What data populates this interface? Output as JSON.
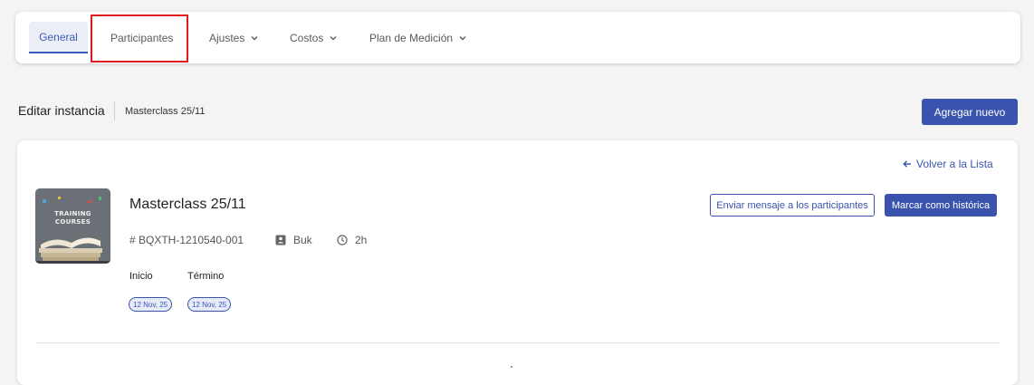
{
  "tabs": [
    {
      "label": "General",
      "active": true
    },
    {
      "label": "Participantes",
      "highlighted": true
    },
    {
      "label": "Ajustes",
      "has_dropdown": true
    },
    {
      "label": "Costos",
      "has_dropdown": true
    },
    {
      "label": "Plan de Medición",
      "has_dropdown": true
    }
  ],
  "header": {
    "title": "Editar instancia",
    "breadcrumb": "Masterclass 25/11",
    "add_button": "Agregar nuevo"
  },
  "card": {
    "back_link": "Volver a la Lista",
    "course_title": "Masterclass 25/11",
    "code": "# BQXTH-1210540-001",
    "owner": "Buk",
    "duration": "2h",
    "start_label": "Inicio",
    "end_label": "Término",
    "start_date": "12 Nov, 25",
    "end_date": "12 Nov, 25",
    "message_button": "Enviar mensaje a los participantes",
    "historic_button": "Marcar como histórica",
    "thumbnail_text": [
      "TRAINING",
      "COURSES"
    ]
  },
  "colors": {
    "accent": "#3a54ad",
    "highlight": "#e0191f",
    "background": "#f4f4f5"
  },
  "icons": {
    "back": "arrow-left-icon",
    "owner": "id-card-icon",
    "duration": "clock-icon",
    "dropdown": "chevron-down-icon"
  }
}
